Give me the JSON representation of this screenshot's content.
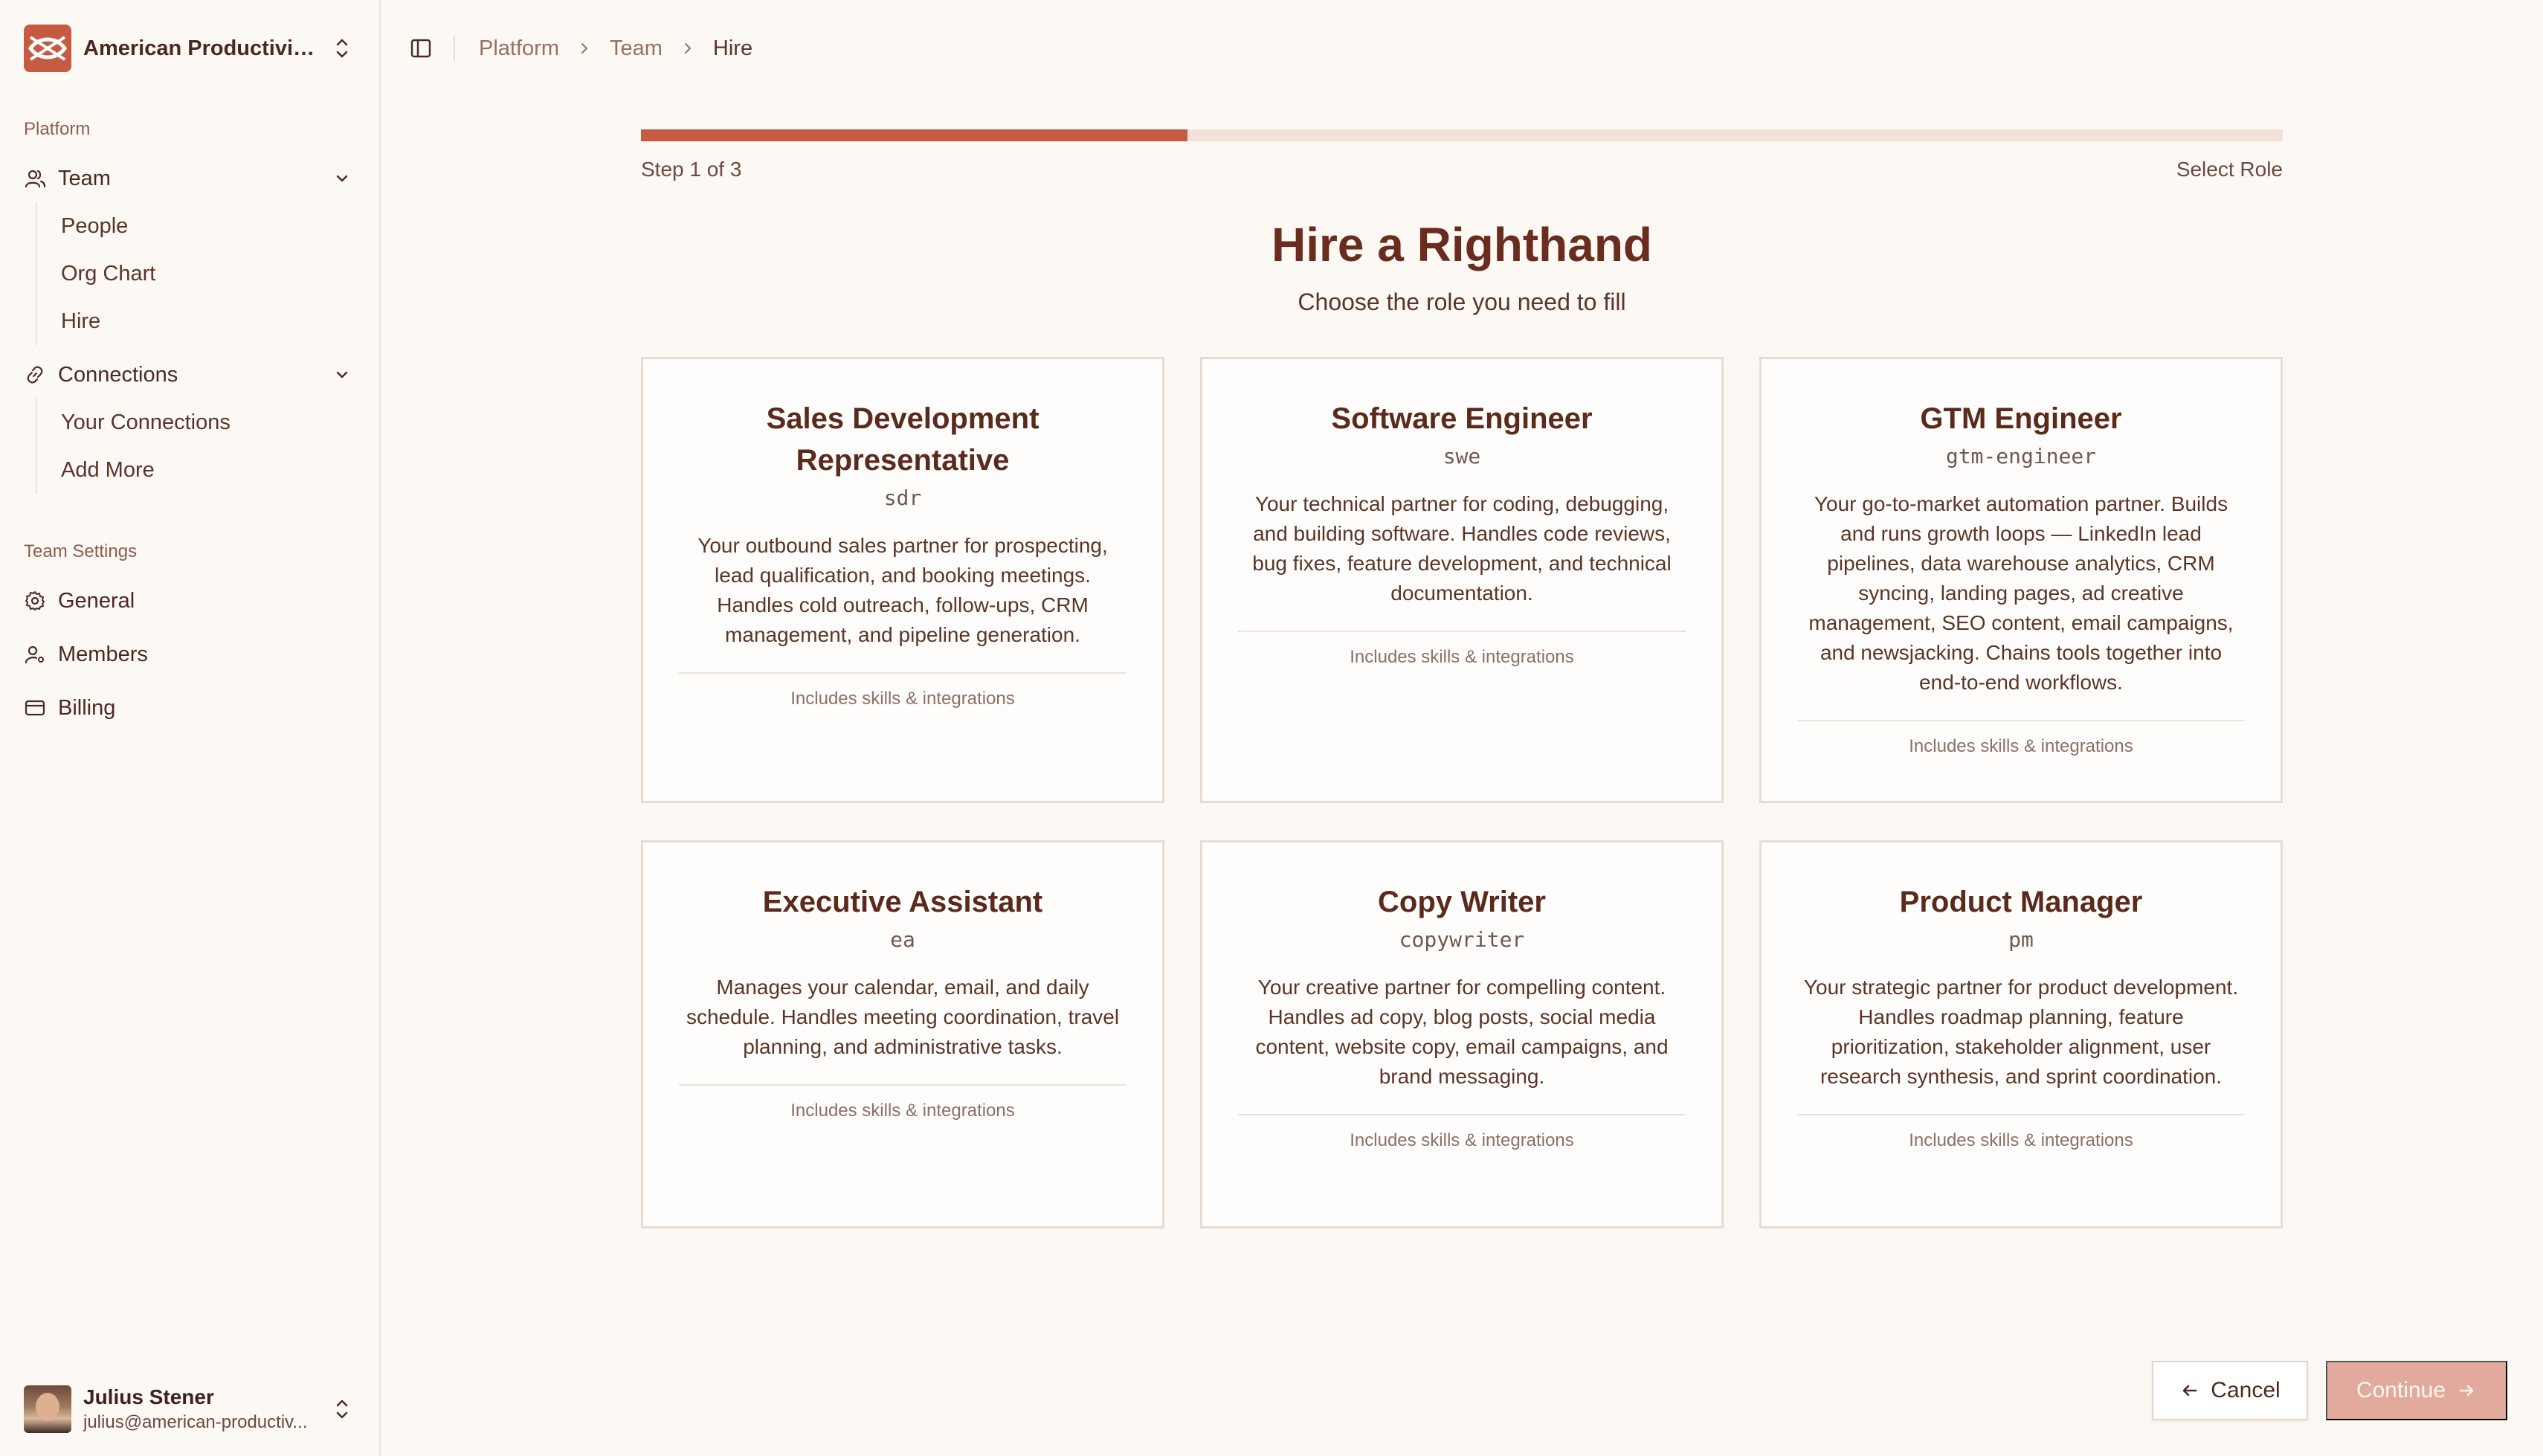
{
  "org": {
    "name": "American Productivity..."
  },
  "sidebar": {
    "platform_label": "Platform",
    "team": {
      "label": "Team",
      "children": [
        "People",
        "Org Chart",
        "Hire"
      ]
    },
    "connections": {
      "label": "Connections",
      "children": [
        "Your Connections",
        "Add More"
      ]
    },
    "settings_label": "Team Settings",
    "settings": [
      "General",
      "Members",
      "Billing"
    ]
  },
  "user": {
    "name": "Julius Stener",
    "email": "julius@american-productiv..."
  },
  "breadcrumb": [
    "Platform",
    "Team",
    "Hire"
  ],
  "wizard": {
    "step_label": "Step 1 of 3",
    "step_name": "Select Role",
    "progress": 0.333,
    "title": "Hire a Righthand",
    "subtitle": "Choose the role you need to fill"
  },
  "roles": [
    {
      "title": "Sales Development Representative",
      "slug": "sdr",
      "description": "Your outbound sales partner for prospecting, lead qualification, and booking meetings. Handles cold outreach, follow-ups, CRM management, and pipeline generation.",
      "footer": "Includes skills & integrations"
    },
    {
      "title": "Software Engineer",
      "slug": "swe",
      "description": "Your technical partner for coding, debugging, and building software. Handles code reviews, bug fixes, feature development, and technical documentation.",
      "footer": "Includes skills & integrations"
    },
    {
      "title": "GTM Engineer",
      "slug": "gtm-engineer",
      "description": "Your go-to-market automation partner. Builds and runs growth loops — LinkedIn lead pipelines, data warehouse analytics, CRM syncing, landing pages, ad creative management, SEO content, email campaigns, and newsjacking. Chains tools together into end-to-end workflows.",
      "footer": "Includes skills & integrations"
    },
    {
      "title": "Executive Assistant",
      "slug": "ea",
      "description": "Manages your calendar, email, and daily schedule. Handles meeting coordination, travel planning, and administrative tasks.",
      "footer": "Includes skills & integrations"
    },
    {
      "title": "Copy Writer",
      "slug": "copywriter",
      "description": "Your creative partner for compelling content. Handles ad copy, blog posts, social media content, website copy, email campaigns, and brand messaging.",
      "footer": "Includes skills & integrations"
    },
    {
      "title": "Product Manager",
      "slug": "pm",
      "description": "Your strategic partner for product development. Handles roadmap planning, feature prioritization, stakeholder alignment, user research synthesis, and sprint coordination.",
      "footer": "Includes skills & integrations"
    }
  ],
  "actions": {
    "cancel": "Cancel",
    "continue": "Continue"
  },
  "colors": {
    "accent": "#c75b42",
    "track": "#f3e2da",
    "continue_disabled": "#e2aa9d"
  }
}
